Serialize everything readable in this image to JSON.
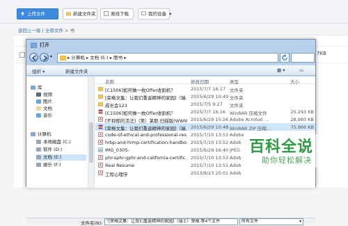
{
  "background": {
    "toolbar": {
      "upload_label": "上传文件",
      "new_folder_label": "新建文件夹",
      "offline_label": "离线下载",
      "device_label": "我的设备"
    },
    "breadcrumb": {
      "back": "返回上一级",
      "sep1": "|",
      "all": "全部文件",
      "sep2": ">",
      "current": "书"
    },
    "file_size": "7KB"
  },
  "dialog": {
    "title": "打开",
    "address_path": [
      "计算机",
      "文档 (E:)",
      "图书"
    ],
    "commands": {
      "organize": "组织 ▾",
      "new_folder": "新建文件夹"
    },
    "nav": {
      "libraries": "库",
      "video": "视频",
      "pictures": "图片",
      "documents": "文档",
      "music": "音乐",
      "computer": "计算机",
      "disk_c": "本地磁盘 (C:)",
      "disk_d": "软件 (D:)",
      "disk_e": "文档 (E:)",
      "disk_f": "娱乐 (F:)"
    },
    "columns": {
      "name": "名称",
      "date": "修改日期",
      "type": "类型",
      "size": "大小"
    },
    "files": [
      {
        "icon": "folder",
        "name": "[C1506]如何做一枚Offer收割机？",
        "date": "2015/7/7 16:17",
        "type": "文件夹",
        "size": ""
      },
      {
        "icon": "folder",
        "name": "[荣格文集：让我们重返精神的家园]（瑞...",
        "date": "2015/6/29 10:49",
        "type": "文件夹",
        "size": ""
      },
      {
        "icon": "folder",
        "name": "成长会123",
        "date": "2015/7/5 9:27",
        "type": "文件夹",
        "size": ""
      },
      {
        "icon": "rar",
        "name": "[C1506]如何做一枚Offer收割机？",
        "date": "2015/7/7 16:16",
        "type": "WinRAR 压缩文件",
        "size": "25,293 KB"
      },
      {
        "icon": "pdf",
        "name": "[不抑郁的活法]（美）莱斯.扫描版(WWW...",
        "date": "2015/6/29 15:26",
        "type": "Adobe Acrobat ...",
        "size": "28,980 KB"
      },
      {
        "icon": "rar",
        "name": "[荣格文集：让我们重返精神的家园]（瑞...",
        "date": "2015/6/29 10:48",
        "type": "WinRAR ZIP 压缩...",
        "size": "75,966 KB",
        "selected": true
      },
      {
        "icon": "pdf",
        "name": "code-of-ethical-and-professional-res...",
        "date": "2015/7/10 13:53",
        "type": "Adobe",
        "size": ""
      },
      {
        "icon": "pdf",
        "name": "hrbp-and-hrmp-certification-handbo...",
        "date": "2015/7/10 13:52",
        "type": "Adob",
        "size": ""
      },
      {
        "icon": "img",
        "name": "IMG_0305-",
        "date": "2015/6/29 16:40",
        "type": "JPEG",
        "size": ""
      },
      {
        "icon": "pdf",
        "name": "phr-sphr-gphr-and-california-certific...",
        "date": "2015/7/10 13:53",
        "type": "Adob",
        "size": ""
      },
      {
        "icon": "pdf",
        "name": "Real Resume",
        "date": "2015/7/10 13:51",
        "type": "Adob",
        "size": ""
      },
      {
        "icon": "pdf",
        "name": "工程心理学",
        "date": "2013/8/23 20:01",
        "type": "Adob",
        "size": ""
      }
    ],
    "filename_label": "文件名(N):",
    "filename_value": "\"[荣格文集：让我们重返精神的家园]（瑞士）荣格.等4个文件",
    "filter_value": "所有文件"
  },
  "watermark": {
    "big": "百科全说",
    "small": "助你轻松解决"
  },
  "colors": {
    "accent": "#3e8ae0",
    "dialog_chrome": "#b9d1ea",
    "selection": "#cfe5fa",
    "watermark": "#2e9b42"
  }
}
